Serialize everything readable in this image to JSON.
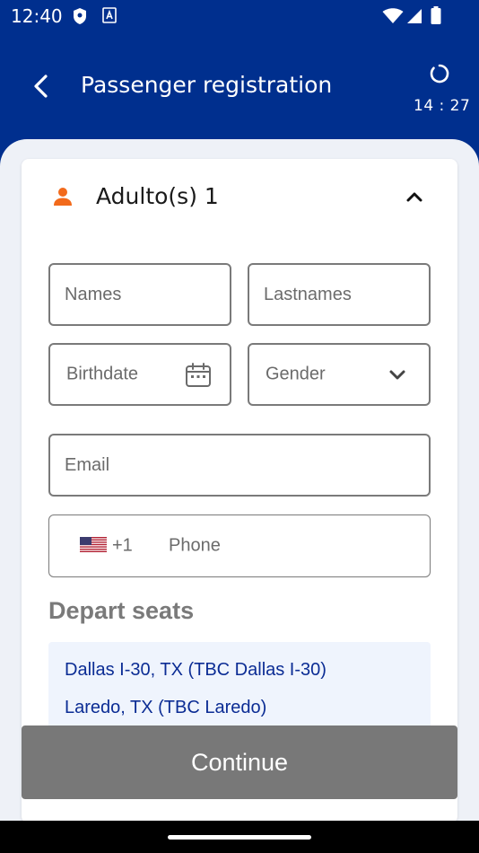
{
  "status_bar": {
    "time": "12:40"
  },
  "header": {
    "title": "Passenger registration",
    "timer": "14 : 27"
  },
  "passenger_section": {
    "title": "Adulto(s) 1"
  },
  "form": {
    "names_placeholder": "Names",
    "lastnames_placeholder": "Lastnames",
    "birthdate_placeholder": "Birthdate",
    "gender_placeholder": "Gender",
    "email_placeholder": "Email",
    "phone_country_code": "+1",
    "phone_placeholder": "Phone"
  },
  "seats": {
    "title": "Depart seats",
    "routes": [
      "Dallas I-30, TX (TBC Dallas I-30)",
      "Laredo, TX (TBC Laredo)"
    ]
  },
  "continue_label": "Continue",
  "colors": {
    "primary": "#002f8e",
    "accent": "#f26a1b",
    "link": "#0b2c94",
    "disabled_button": "#787878"
  }
}
